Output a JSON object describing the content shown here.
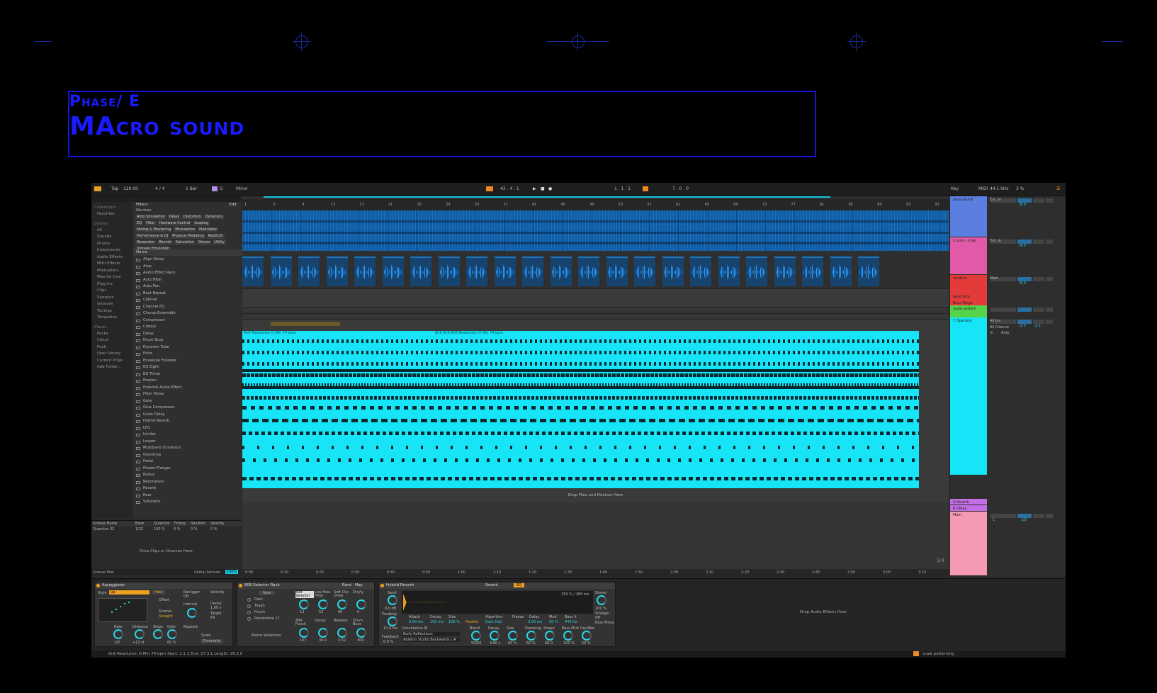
{
  "slide": {
    "phase": "Phase/ E",
    "title": "MAcro sound"
  },
  "topbar": {
    "tap": "Tap",
    "tempo": "120.00",
    "signature": "4 / 4",
    "quantize": "1 Bar",
    "key_root": "G",
    "scale": "Minor",
    "position": "42 . 4 . 1",
    "loop_start": "1 . 1 . 1",
    "loop_length": "7 . 0 . 0",
    "key": "Key",
    "midi": "MIDI",
    "sample_rate": "44.1 kHz",
    "cpu": "3 %"
  },
  "sidebar": {
    "collections_label": "Collections",
    "favorites": "Favorites",
    "library_label": "Library",
    "library": [
      "All",
      "Sounds",
      "Drums",
      "Instruments",
      "Audio Effects",
      "MIDI Effects",
      "Modulators",
      "Max for Live",
      "Plug-ins",
      "Clips",
      "Samples",
      "Grooves",
      "Tunings",
      "Templates"
    ],
    "places_label": "Places",
    "places": [
      "Packs",
      "Cloud",
      "Push",
      "User Library",
      "Current Proje",
      "Add Folder..."
    ]
  },
  "browser": {
    "filters": "Filters",
    "edit": "Edit",
    "devices": "Devices",
    "tags": [
      "Amp Simulation",
      "Delay",
      "Distortion",
      "Dynamics",
      "EQ",
      "Filter",
      "Hardware Control",
      "Looping",
      "Mixing & Mastering",
      "Modulation",
      "Modulator",
      "Performance & DJ",
      "Physical Modeling",
      "Reptitch",
      "Resonator",
      "Reverb",
      "Saturation",
      "Stereo",
      "Utility",
      "Vintage Emulation"
    ],
    "name_header": "Name",
    "items": [
      "Align Delay",
      "Amp",
      "Audio Effect Rack",
      "Auto Filter",
      "Auto Pan",
      "Beat Repeat",
      "Cabinet",
      "Channel EQ",
      "Chorus-Ensemble",
      "Compressor",
      "Corpus",
      "Delay",
      "Drum Buss",
      "Dynamic Tube",
      "Echo",
      "Envelope Follower",
      "EQ Eight",
      "EQ Three",
      "Erosion",
      "External Audio Effect",
      "Filter Delay",
      "Gate",
      "Glue Compressor",
      "Grain Delay",
      "Hybrid Reverb",
      "LFO",
      "Limiter",
      "Looper",
      "Multiband Dynamics",
      "Overdrive",
      "Pedal",
      "Phaser-Flanger",
      "Redux",
      "Resonators",
      "Reverb",
      "Roar",
      "Saturator"
    ]
  },
  "groove": {
    "cols": [
      "Groove Name",
      "Base",
      "Quantize",
      "Timing",
      "Random",
      "Velocity"
    ],
    "row": [
      "Quantize 32",
      "1/32",
      "100 %",
      "0 %",
      "0 %",
      "0 %"
    ],
    "drop": "Drop Clips or Grooves Here",
    "pool": "Groove Pool",
    "global": "Global Amount",
    "global_val": "100%"
  },
  "arrangement": {
    "ruler": [
      "1",
      "5",
      "9",
      "13",
      "17",
      "21",
      "25",
      "29",
      "33",
      "37",
      "41",
      "45",
      "49",
      "53",
      "57",
      "61",
      "65",
      "69",
      "73",
      "77",
      "81",
      "85",
      "89",
      "93",
      "97"
    ],
    "clip1": "8n8 Resolution O Min 74 bpm",
    "clip2": "8n8 8n8 8n8 Resolution O Min 74 bpm",
    "drop": "Drop Files and Devices Here",
    "zoom": "1/4",
    "times": [
      "0:00",
      "0:10",
      "0:20",
      "0:30",
      "0:40",
      "0:50",
      "1:00",
      "1:10",
      "1:20",
      "1:30",
      "1:40",
      "1:50",
      "2:00",
      "2:10",
      "2:20",
      "2:30",
      "2:40",
      "2:50",
      "3:00",
      "3:10"
    ]
  },
  "tracks": [
    {
      "name": "bass sound",
      "color": "#5a7fe0"
    },
    {
      "name": "2 juno - a bar",
      "color": "#e25aa7"
    },
    {
      "name": "rotation",
      "color": "#e33a3a"
    },
    {
      "name": "beat slice",
      "color": "#e33a3a"
    },
    {
      "name": "Bear Hinge",
      "color": "#e33a3a"
    },
    {
      "name": "scale pattern",
      "color": "#55d34a"
    },
    {
      "name": "7 Operator",
      "color": "#16e4f7"
    },
    {
      "name": "A Reverb",
      "color": "#c46ee6"
    },
    {
      "name": "B Delay",
      "color": "#c46ee6"
    },
    {
      "name": "Main",
      "color": "#f59ab4"
    }
  ],
  "mixer": {
    "io": [
      "Ext. In",
      "Main",
      "All Ins",
      "All Channe",
      "In",
      "Auto",
      "Off"
    ],
    "vals": [
      "-6.0",
      "-4.0",
      "-6.0",
      "-2.0",
      "-2.2",
      "1/2",
      "C"
    ]
  },
  "devices": {
    "arp": {
      "name": "Arpeggiator",
      "style_label": "Style",
      "style": "Up",
      "hold": "Hold",
      "offset": "Offset",
      "groove": "Groove",
      "groove_val": "Straight",
      "rate": "Rate",
      "rate_val": "1/8",
      "distance": "Distance",
      "distance_val": "+12 st",
      "steps": "Steps",
      "gate": "Gate",
      "gate_val": "60 %",
      "retrigger": "Retrigger",
      "off": "Off",
      "velocity": "Velocity",
      "decay": "Decay",
      "decay_val": "1.00 s",
      "target": "Target",
      "target_val": "64",
      "interval": "Interval",
      "repeats": "Repeats",
      "scale": "Scale",
      "scale_val": "Chromatic"
    },
    "rack": {
      "name": "808 Selector Rack",
      "rand": "Rand",
      "map": "Map",
      "new": "New",
      "variations": [
        "Dark",
        "Tough",
        "Punch",
        "Randomize 17"
      ],
      "macro_label": "Macro Variations",
      "macros": [
        "808 Selector",
        "Low Pass Filter",
        "Soft Clip Drive",
        "Dry/ly",
        "Add Punch",
        "Decay",
        "Release",
        "Drum Buss"
      ],
      "macro_vals": [
        "13",
        "53",
        "60",
        "0",
        "107",
        "30.0",
        "3.52",
        "300"
      ]
    },
    "reverb": {
      "name": "Hybrid Reverb",
      "tab1": "Reverb",
      "tab2": "EQ",
      "send": "Send",
      "send_val": "0.0 dB",
      "predelay": "Predelay",
      "predelay_val": "10.0 ms",
      "feedback": "Feedback",
      "feedback_val": "0.0 %",
      "attack": "Attack",
      "attack_val": "0.00 ms",
      "decay": "Decay",
      "decay_val": "100 ms",
      "size": "Size",
      "size_val": "100 %",
      "routing": "Parallel",
      "algorithm": "Algorithm",
      "algorithm_val": "Dark Hall",
      "freeze": "Freeze",
      "delay": "Delay",
      "delay_val": "3.00 ms",
      "mod": "Mod",
      "mod_val": "50 %",
      "bass_x": "Bass X",
      "bass_x_val": "440 Hz",
      "ir_label": "Convolution IR",
      "ir1": "Early Reflections",
      "ir2": "Ableton Studio Backwards L-R",
      "blend": "Blend",
      "blend_val": "50/50",
      "damping": "Damping",
      "shape": "Shape",
      "bass_mult": "Bass Mult",
      "dry_wet": "Dry/Wet",
      "stereo": "Stereo",
      "stereo_val": "100 %",
      "vintage": "Vintage",
      "vintage_val": "Off",
      "bass_mono": "Bass Mono",
      "range": "150 % / 285 ms",
      "k_decay": "3.60 s",
      "k_size": "60 %",
      "k_damp": "60 %",
      "k_shape": "60.0",
      "k_bm": "100 %",
      "k_dw": "50 %"
    },
    "drop": "Drop Audio Effects Here"
  },
  "status": {
    "clip": "8n8 Resolution O Min 74 bpm  Start: 1.1.1  End: 27.3.1  Length: 26.2.0",
    "track": "scale patterning"
  },
  "colors": {
    "blue_clip": "#1a76c6",
    "cyan_clip": "#17e4f7",
    "title": "#1a1aff"
  }
}
